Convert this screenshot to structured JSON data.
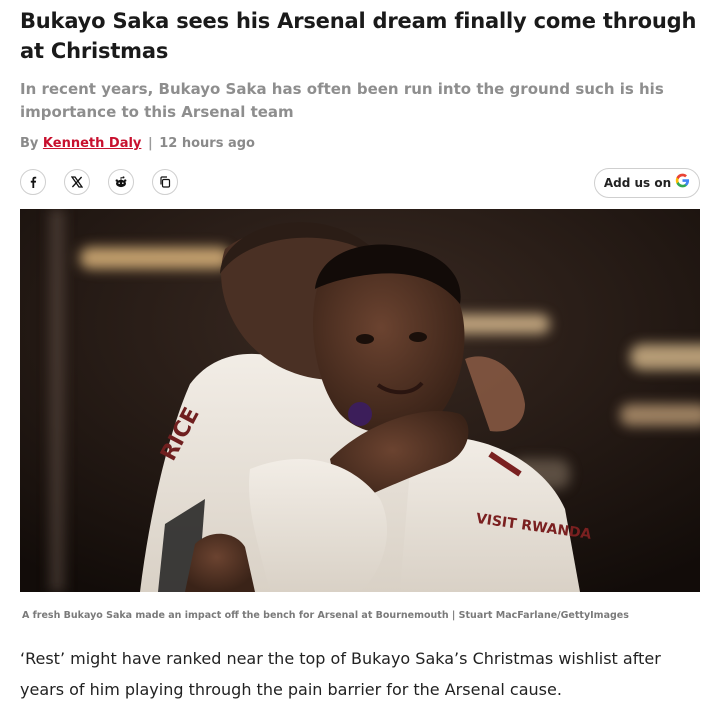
{
  "article": {
    "headline": "Bukayo Saka sees his Arsenal dream finally come through at Christmas",
    "standfirst": "In recent years, Bukayo Saka has often been run into the ground such is his importance to this Arsenal team",
    "byline": {
      "prefix": "By",
      "author": "Kenneth Daly",
      "separator": "|",
      "timestamp": "12 hours ago"
    },
    "share": {
      "buttons": [
        {
          "icon": "facebook-icon",
          "glyph": "f"
        },
        {
          "icon": "x-icon",
          "glyph": "𝕏"
        },
        {
          "icon": "reddit-icon",
          "glyph": "reddit"
        },
        {
          "icon": "copy-link-icon",
          "glyph": "copy"
        }
      ]
    },
    "add_us": {
      "label": "Add us on",
      "icon": "google-g-icon",
      "glyph": "G"
    },
    "image": {
      "caption": "A fresh Bukayo Saka made an impact off the bench for Arsenal at Bournemouth | Stuart MacFarlane/GettyImages",
      "shirt_name": "RICE",
      "shirt_sponsor": "VISIT RWANDA"
    },
    "body": "‘Rest’ might have ranked near the top of Bukayo Saka’s Christmas wishlist after years of him playing through the pain barrier for the Arsenal cause."
  },
  "colors": {
    "author_link": "#c8102e",
    "standfirst": "#8e8e8e",
    "google_blue": "#4285f4",
    "google_red": "#ea4335",
    "google_yellow": "#fbbc05",
    "google_green": "#34a853"
  }
}
